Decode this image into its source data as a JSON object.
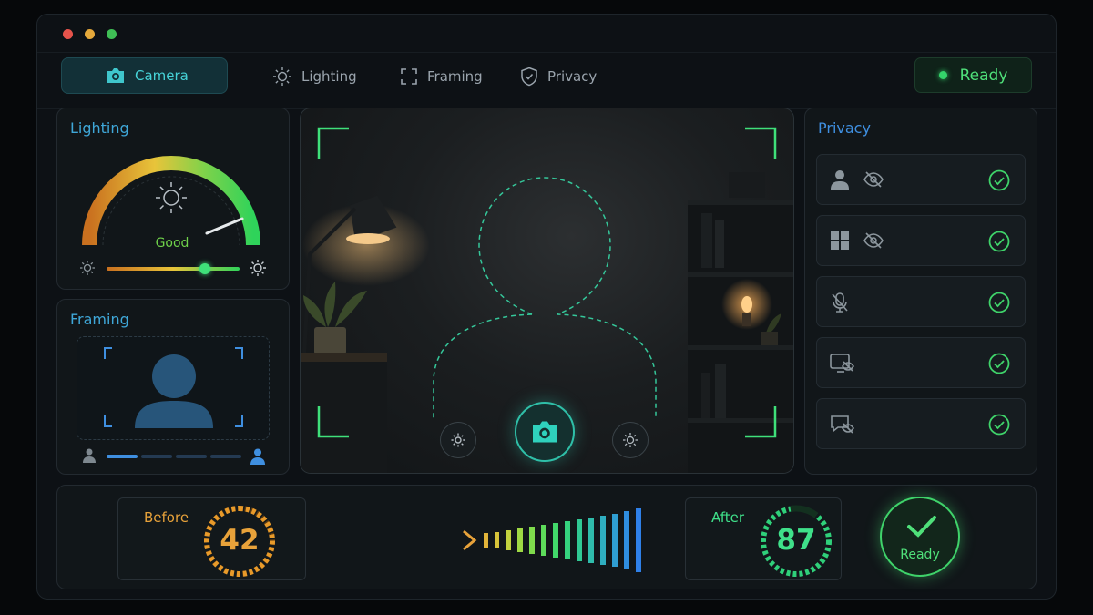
{
  "nav": {
    "tabs": [
      {
        "label": "Camera",
        "icon": "camera-icon",
        "active": true
      },
      {
        "label": "Lighting",
        "icon": "sun-icon",
        "active": false
      },
      {
        "label": "Framing",
        "icon": "frame-icon",
        "active": false
      },
      {
        "label": "Privacy",
        "icon": "shield-icon",
        "active": false
      }
    ],
    "status": "Ready"
  },
  "lighting": {
    "title": "Lighting",
    "status": "Good",
    "level": 0.82
  },
  "framing": {
    "title": "Framing",
    "segments_filled": 1,
    "segments_total": 4
  },
  "privacy": {
    "title": "Privacy",
    "items": [
      {
        "icon": "person-icon",
        "secondary_icon": "eye-off-icon",
        "checked": true
      },
      {
        "icon": "grid-icon",
        "secondary_icon": "eye-off-icon",
        "checked": true
      },
      {
        "icon": "mic-off-icon",
        "checked": true
      },
      {
        "icon": "screen-off-icon",
        "checked": true
      },
      {
        "icon": "chat-off-icon",
        "checked": true
      }
    ]
  },
  "scores": {
    "before_label": "Before",
    "before_value": "42",
    "after_label": "After",
    "after_value": "87",
    "status_label": "Ready"
  },
  "colors": {
    "accent": "#46d3d8",
    "ready_green": "#4fe07a",
    "before_orange": "#e8a23a",
    "after_green": "#3fe08a",
    "privacy_blue": "#3f8fe0"
  }
}
